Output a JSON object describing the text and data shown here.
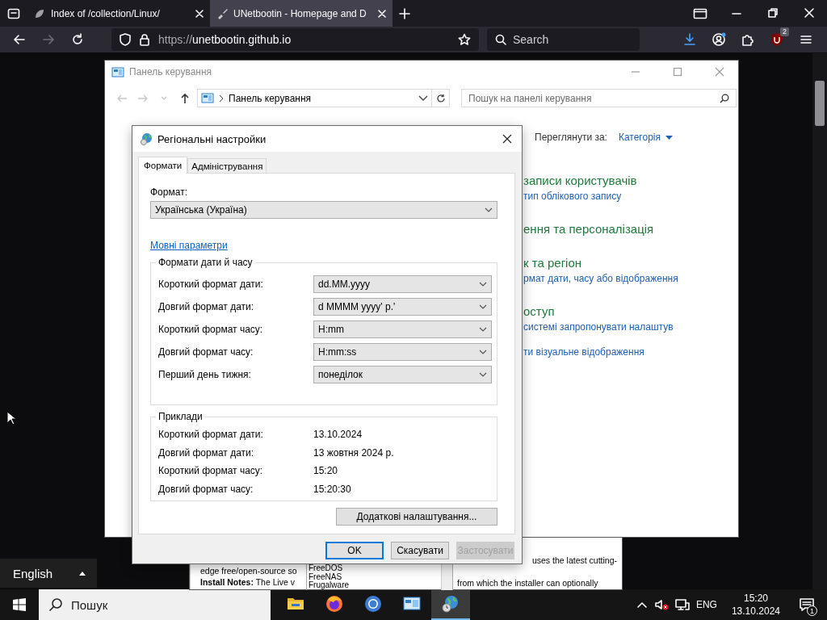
{
  "browser": {
    "tabs": [
      {
        "title": "Index of /collection/Linux/",
        "selected": false
      },
      {
        "title": "UNetbootin - Homepage and D",
        "selected": true
      }
    ],
    "nav_buttons": [
      {
        "kind": "back",
        "disabled": false
      },
      {
        "kind": "forward",
        "disabled": true
      },
      {
        "kind": "reload",
        "disabled": false
      }
    ],
    "url": {
      "scheme": "https://",
      "host": "unetbootin.github.io"
    },
    "search": {
      "placeholder": "Search"
    },
    "toolbar": [
      {
        "kind": "download"
      },
      {
        "kind": "account"
      },
      {
        "kind": "extensions"
      },
      {
        "kind": "shield",
        "badge": "2"
      },
      {
        "kind": "menu"
      }
    ]
  },
  "web_page": {
    "left_lines": [
      "edge free/open-source so",
      "**Install Notes:** The Live v"
    ],
    "list_items": [
      "FreeDOS",
      "FreeNAS",
      "Frugalware"
    ],
    "right_lines": [
      "uses the latest cutting-",
      "from which the installer can optionally"
    ]
  },
  "control_panel": {
    "title": "Панель керування",
    "nav_buttons": [
      {
        "kind": "back",
        "disabled": true
      },
      {
        "kind": "forward",
        "disabled": true
      },
      {
        "kind": "recent",
        "disabled": true
      },
      {
        "kind": "up",
        "disabled": false
      }
    ],
    "address": "Панель керування",
    "search": {
      "placeholder": "Пошук на панелі керування"
    },
    "view_by_label": "Переглянути за:",
    "view_by_value": "Категорія",
    "categories": [
      {
        "heading": "записи користувачів",
        "links": [
          "тип облікового запису"
        ]
      },
      {
        "heading": "ення та персоналізація"
      },
      {
        "heading": "к та регіон",
        "links": [
          "рмат дати, часу або відображення"
        ]
      },
      {
        "heading": "оступ",
        "links": [
          "системі запропонувати налаштув",
          "ти візуальне відображення"
        ]
      }
    ]
  },
  "dialog": {
    "title": "Регіональні настройки",
    "tabs": [
      {
        "label": "Формати",
        "selected": true
      },
      {
        "label": "Адміністрування",
        "selected": false
      }
    ],
    "format_label": "Формат:",
    "format_value": "Українська (Україна)",
    "language_link": "Мовні параметри",
    "date_time_group": {
      "title": "Формати дати й часу",
      "rows": [
        {
          "label": "Короткий формат дати:",
          "value": "dd.MM.yyyy"
        },
        {
          "label": "Довгий формат дати:",
          "value": "d MMMM yyyy' р.'"
        },
        {
          "label": "Короткий формат часу:",
          "value": "H:mm"
        },
        {
          "label": "Довгий формат часу:",
          "value": "H:mm:ss"
        },
        {
          "label": "Перший день тижня:",
          "value": "понеділок"
        }
      ]
    },
    "examples_group": {
      "title": "Приклади",
      "rows": [
        {
          "label": "Короткий формат дати:",
          "value": "13.10.2024"
        },
        {
          "label": "Довгий формат дати:",
          "value": "13 жовтня 2024 р."
        },
        {
          "label": "Короткий формат часу:",
          "value": "15:20"
        },
        {
          "label": "Довгий формат часу:",
          "value": "15:20:30"
        }
      ]
    },
    "additional_button": "Додаткові налаштування...",
    "buttons": [
      {
        "label": "OK",
        "default": true,
        "disabled": false
      },
      {
        "label": "Скасувати",
        "default": false,
        "disabled": false
      },
      {
        "label": "Застосувати",
        "default": false,
        "disabled": true
      }
    ]
  },
  "language_popup": {
    "label": "English"
  },
  "taskbar": {
    "search_placeholder": "Пошук",
    "apps": [
      {
        "kind": "folder",
        "selected": false
      },
      {
        "kind": "firefox",
        "selected": false
      },
      {
        "kind": "chromium",
        "selected": false
      },
      {
        "kind": "control-panel",
        "selected": false
      },
      {
        "kind": "globe",
        "selected": true
      }
    ],
    "language": "ENG",
    "time": "15:20",
    "date": "13.10.2024",
    "notifications": "1"
  }
}
